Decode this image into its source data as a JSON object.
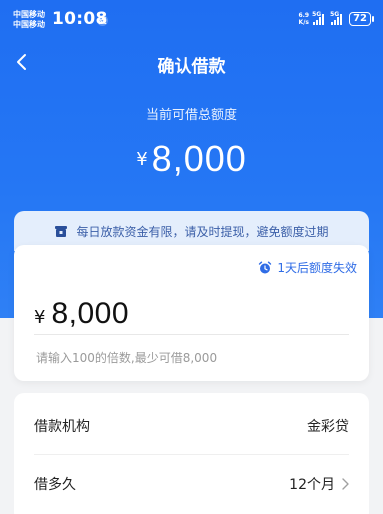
{
  "status_bar": {
    "carrier_1": "中国移动",
    "carrier_2": "中国移动",
    "time": "10:08",
    "pay_icon_glyph": "支",
    "net_speed_value": "6.9",
    "net_speed_unit": "K/s",
    "signal_1_tag": "5G",
    "signal_2_tag": "5G",
    "battery": "72"
  },
  "nav": {
    "title": "确认借款",
    "back_icon": "chevron-left-icon"
  },
  "quota": {
    "label": "当前可借总额度",
    "currency": "¥",
    "amount": "8,000"
  },
  "notice": {
    "icon": "wallet-icon",
    "text": "每日放款资金有限，请及时提现，避免额度过期"
  },
  "borrow": {
    "expire_icon": "alarm-clock-icon",
    "expire_text": "1天后额度失效",
    "currency": "¥",
    "amount_value": "8,000",
    "hint": "请输入100的倍数,最少可借8,000"
  },
  "details": {
    "rows": [
      {
        "label": "借款机构",
        "value": "金彩贷"
      },
      {
        "label": "借多久",
        "value": "12个月"
      }
    ]
  },
  "colors": {
    "brand_blue": "#2577f4",
    "notice_bg": "#e4eefc",
    "accent_text": "#2f6ce6"
  }
}
